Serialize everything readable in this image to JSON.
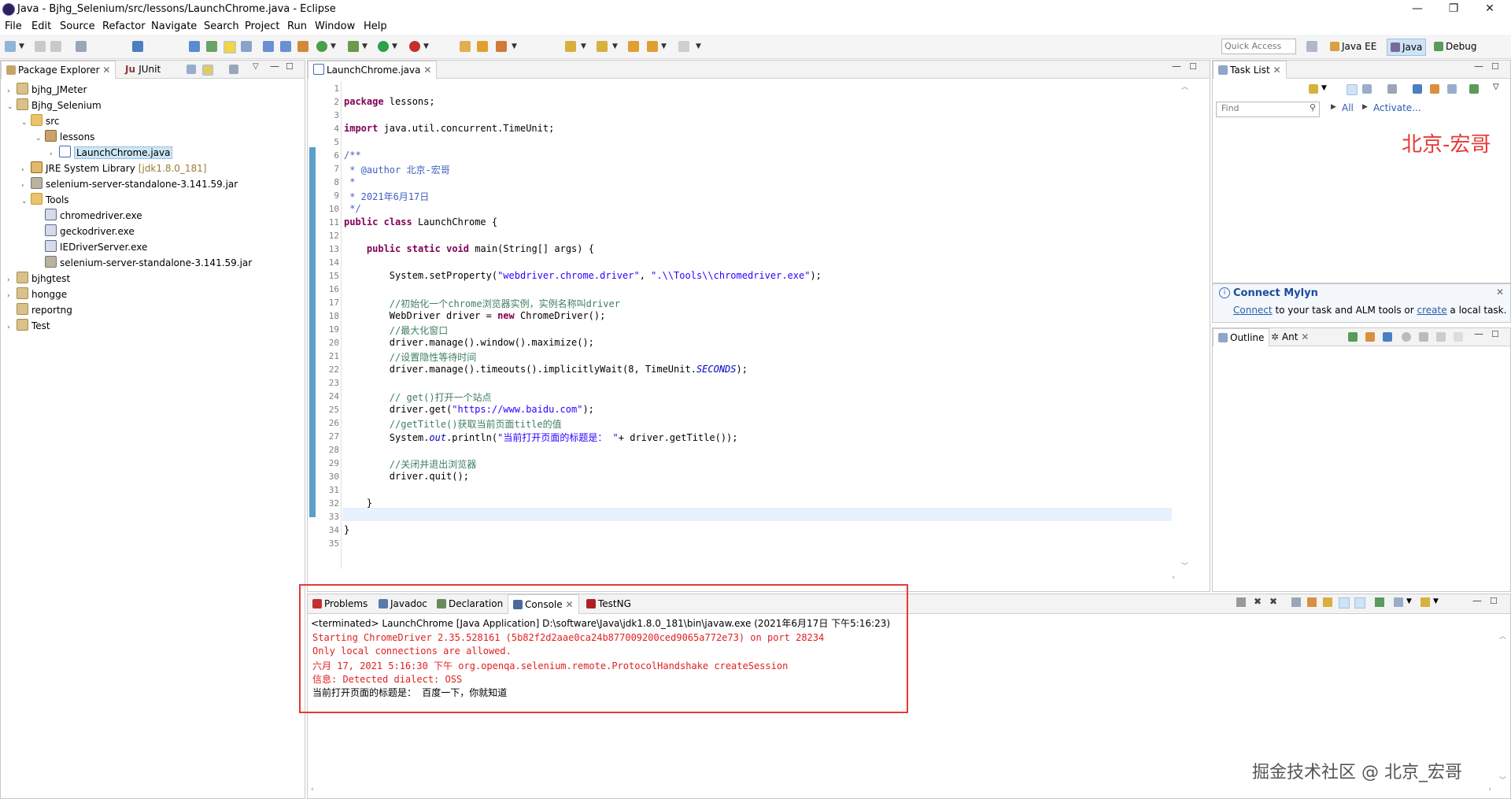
{
  "window": {
    "title": "Java - Bjhg_Selenium/src/lessons/LaunchChrome.java - Eclipse"
  },
  "menu": [
    "File",
    "Edit",
    "Source",
    "Refactor",
    "Navigate",
    "Search",
    "Project",
    "Run",
    "Window",
    "Help"
  ],
  "toolbar": {
    "quick_access": "Quick Access"
  },
  "perspectives": [
    {
      "label": "Java EE"
    },
    {
      "label": "Java"
    },
    {
      "label": "Debug"
    }
  ],
  "package_explorer": {
    "tabs": [
      "Package Explorer",
      "JUnit"
    ],
    "tree": [
      {
        "label": "bjhg_JMeter",
        "depth": 0,
        "toggle": "›",
        "icon": "proj"
      },
      {
        "label": "Bjhg_Selenium",
        "depth": 0,
        "toggle": "⌄",
        "icon": "proj"
      },
      {
        "label": "src",
        "depth": 1,
        "toggle": "⌄",
        "icon": "folder"
      },
      {
        "label": "lessons",
        "depth": 2,
        "toggle": "⌄",
        "icon": "pkg"
      },
      {
        "label": "LaunchChrome.java",
        "depth": 3,
        "toggle": "›",
        "icon": "java",
        "selected": true
      },
      {
        "label": "JRE System Library",
        "suffix": "[jdk1.8.0_181]",
        "depth": 1,
        "toggle": "›",
        "icon": "lib"
      },
      {
        "label": "selenium-server-standalone-3.141.59.jar",
        "depth": 1,
        "toggle": "›",
        "icon": "jar"
      },
      {
        "label": "Tools",
        "depth": 1,
        "toggle": "⌄",
        "icon": "folder"
      },
      {
        "label": "chromedriver.exe",
        "depth": 2,
        "toggle": "",
        "icon": "exe"
      },
      {
        "label": "geckodriver.exe",
        "depth": 2,
        "toggle": "",
        "icon": "exe"
      },
      {
        "label": "IEDriverServer.exe",
        "depth": 2,
        "toggle": "",
        "icon": "exe"
      },
      {
        "label": "selenium-server-standalone-3.141.59.jar",
        "depth": 2,
        "toggle": "",
        "icon": "jar"
      },
      {
        "label": "bjhgtest",
        "depth": 0,
        "toggle": "›",
        "icon": "proj"
      },
      {
        "label": "hongge",
        "depth": 0,
        "toggle": "›",
        "icon": "proj"
      },
      {
        "label": "reportng",
        "depth": 0,
        "toggle": "",
        "icon": "proj"
      },
      {
        "label": "Test",
        "depth": 0,
        "toggle": "›",
        "icon": "proj"
      }
    ]
  },
  "editor": {
    "tab": "LaunchChrome.java",
    "lines": [
      "",
      "package lessons;",
      "",
      "import java.util.concurrent.TimeUnit;",
      "",
      "/**",
      " * @author 北京-宏哥",
      " *",
      " * 2021年6月17日",
      " */",
      "public class LaunchChrome {",
      "",
      "    public static void main(String[] args) {",
      "",
      "        System.setProperty(\"webdriver.chrome.driver\", \".\\\\Tools\\\\chromedriver.exe\");",
      "",
      "        //初始化一个chrome浏览器实例，实例名称叫driver",
      "        WebDriver driver = new ChromeDriver();",
      "        //最大化窗口",
      "        driver.manage().window().maximize();",
      "        //设置隐性等待时间",
      "        driver.manage().timeouts().implicitlyWait(8, TimeUnit.SECONDS);",
      "",
      "        // get()打开一个站点",
      "        driver.get(\"https://www.baidu.com\");",
      "        //getTitle()获取当前页面title的值",
      "        System.out.println(\"当前打开页面的标题是： \"+ driver.getTitle());",
      "",
      "        //关闭并退出浏览器",
      "        driver.quit();",
      "",
      "    }",
      "",
      "}",
      ""
    ]
  },
  "task_list": {
    "tab": "Task List",
    "find_placeholder": "Find",
    "all": "All",
    "activate": "Activate...",
    "watermark": "北京-宏哥"
  },
  "mylyn": {
    "title": "Connect Mylyn",
    "link1": "Connect",
    "text1": " to your task and ALM tools or ",
    "link2": "create",
    "text2": " a local task."
  },
  "outline": {
    "tabs": [
      "Outline",
      "Ant"
    ]
  },
  "console": {
    "tabs": [
      "Problems",
      "Javadoc",
      "Declaration",
      "Console",
      "TestNG"
    ],
    "header": "<terminated> LaunchChrome [Java Application] D:\\software\\Java\\jdk1.8.0_181\\bin\\javaw.exe (2021年6月17日 下午5:16:23)",
    "lines": [
      {
        "text": "Starting ChromeDriver 2.35.528161 (5b82f2d2aae0ca24b877009200ced9065a772e73) on port 28234",
        "color": "red"
      },
      {
        "text": "Only local connections are allowed.",
        "color": "red"
      },
      {
        "text": "六月 17, 2021 5:16:30 下午 org.openqa.selenium.remote.ProtocolHandshake createSession",
        "color": "red"
      },
      {
        "text": "信息: Detected dialect: OSS",
        "color": "red"
      },
      {
        "text": "当前打开页面的标题是： 百度一下，你就知道",
        "color": "black"
      }
    ]
  },
  "footer_watermark": "掘金技术社区 @ 北京_宏哥",
  "colors": {
    "highlight_box": "#e53935",
    "selection": "#cde6f7",
    "keyword": "#7f0055",
    "string": "#2a00ff",
    "comment": "#3f7f5f"
  }
}
